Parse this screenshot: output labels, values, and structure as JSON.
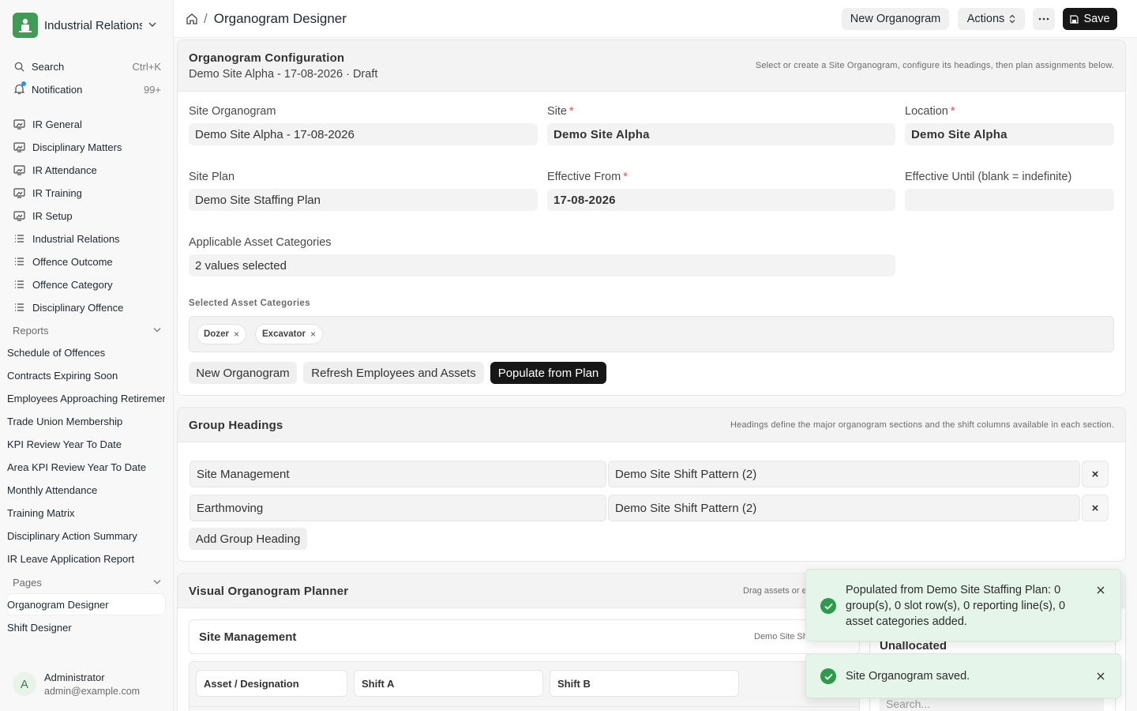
{
  "sidebar": {
    "brand": "Industrial Relations",
    "search_label": "Search",
    "search_shortcut": "Ctrl+K",
    "notification_label": "Notification",
    "notification_count": "99+",
    "workspaces": [
      {
        "label": "IR General",
        "icon": "monitor-icon"
      },
      {
        "label": "Disciplinary Matters",
        "icon": "monitor-icon"
      },
      {
        "label": "IR Attendance",
        "icon": "monitor-icon"
      },
      {
        "label": "IR Training",
        "icon": "monitor-icon"
      },
      {
        "label": "IR Setup",
        "icon": "monitor-icon"
      },
      {
        "label": "Industrial Relations",
        "icon": "list-icon"
      },
      {
        "label": "Offence Outcome",
        "icon": "list-icon"
      },
      {
        "label": "Offence Category",
        "icon": "list-icon"
      },
      {
        "label": "Disciplinary Offence",
        "icon": "list-icon"
      }
    ],
    "reports_label": "Reports",
    "reports": [
      "Schedule of Offences",
      "Contracts Expiring Soon",
      "Employees Approaching Retirement",
      "Trade Union Membership",
      "KPI Review Year To Date",
      "Area KPI Review Year To Date",
      "Monthly Attendance",
      "Training Matrix",
      "Disciplinary Action Summary",
      "IR Leave Application Report"
    ],
    "pages_label": "Pages",
    "pages": [
      "Organogram Designer",
      "Shift Designer"
    ],
    "user_initial": "A",
    "user_name": "Administrator",
    "user_email": "admin@example.com"
  },
  "topbar": {
    "page_title": "Organogram Designer",
    "new_btn": "New Organogram",
    "actions_btn": "Actions",
    "save_btn": "Save"
  },
  "config": {
    "title": "Organogram Configuration",
    "subtitle": "Demo Site Alpha - 17-08-2026 · Draft",
    "hint": "Select or create a Site Organogram, configure its headings, then plan assignments below.",
    "site_organogram_label": "Site Organogram",
    "site_organogram_value": "Demo Site Alpha - 17-08-2026",
    "site_label": "Site",
    "site_value": "Demo Site Alpha",
    "location_label": "Location",
    "location_value": "Demo Site Alpha",
    "site_plan_label": "Site Plan",
    "site_plan_value": "Demo Site Staffing Plan",
    "effective_from_label": "Effective From",
    "effective_from_value": "17-08-2026",
    "effective_until_label": "Effective Until (blank = indefinite)",
    "effective_until_value": "",
    "asset_cat_label": "Applicable Asset Categories",
    "asset_cat_value": "2 values selected",
    "selected_cat_label": "Selected Asset Categories",
    "chips": [
      "Dozer",
      "Excavator"
    ],
    "btn_new": "New Organogram",
    "btn_refresh": "Refresh Employees and Assets",
    "btn_populate": "Populate from Plan"
  },
  "groups": {
    "title": "Group Headings",
    "hint": "Headings define the major organogram sections and the shift columns available in each section.",
    "rows": [
      {
        "heading": "Site Management",
        "pattern": "Demo Site Shift Pattern (2)"
      },
      {
        "heading": "Earthmoving",
        "pattern": "Demo Site Shift Pattern (2)"
      }
    ],
    "add_btn": "Add Group Heading"
  },
  "planner": {
    "title": "Visual Organogram Planner",
    "hint": "Drag assets or e",
    "section_title": "Site Management",
    "section_hint": "Demo Site Sh",
    "col_asset": "Asset / Designation",
    "col_shift_a": "Shift A",
    "col_shift_b": "Shift B",
    "unallocated": "Unallocated",
    "search_placeholder": "Search..."
  },
  "toasts": [
    {
      "message": "Populated from Demo Site Staffing Plan: 0 group(s), 0 slot row(s), 0 reporting line(s), 0 asset categories added."
    },
    {
      "message": "Site Organogram saved."
    }
  ],
  "colors": {
    "accent_dark": "#171717",
    "brand_green": "#3f9c54",
    "success_green": "#2d9a4c",
    "toast_bg": "#e5f5ea"
  }
}
